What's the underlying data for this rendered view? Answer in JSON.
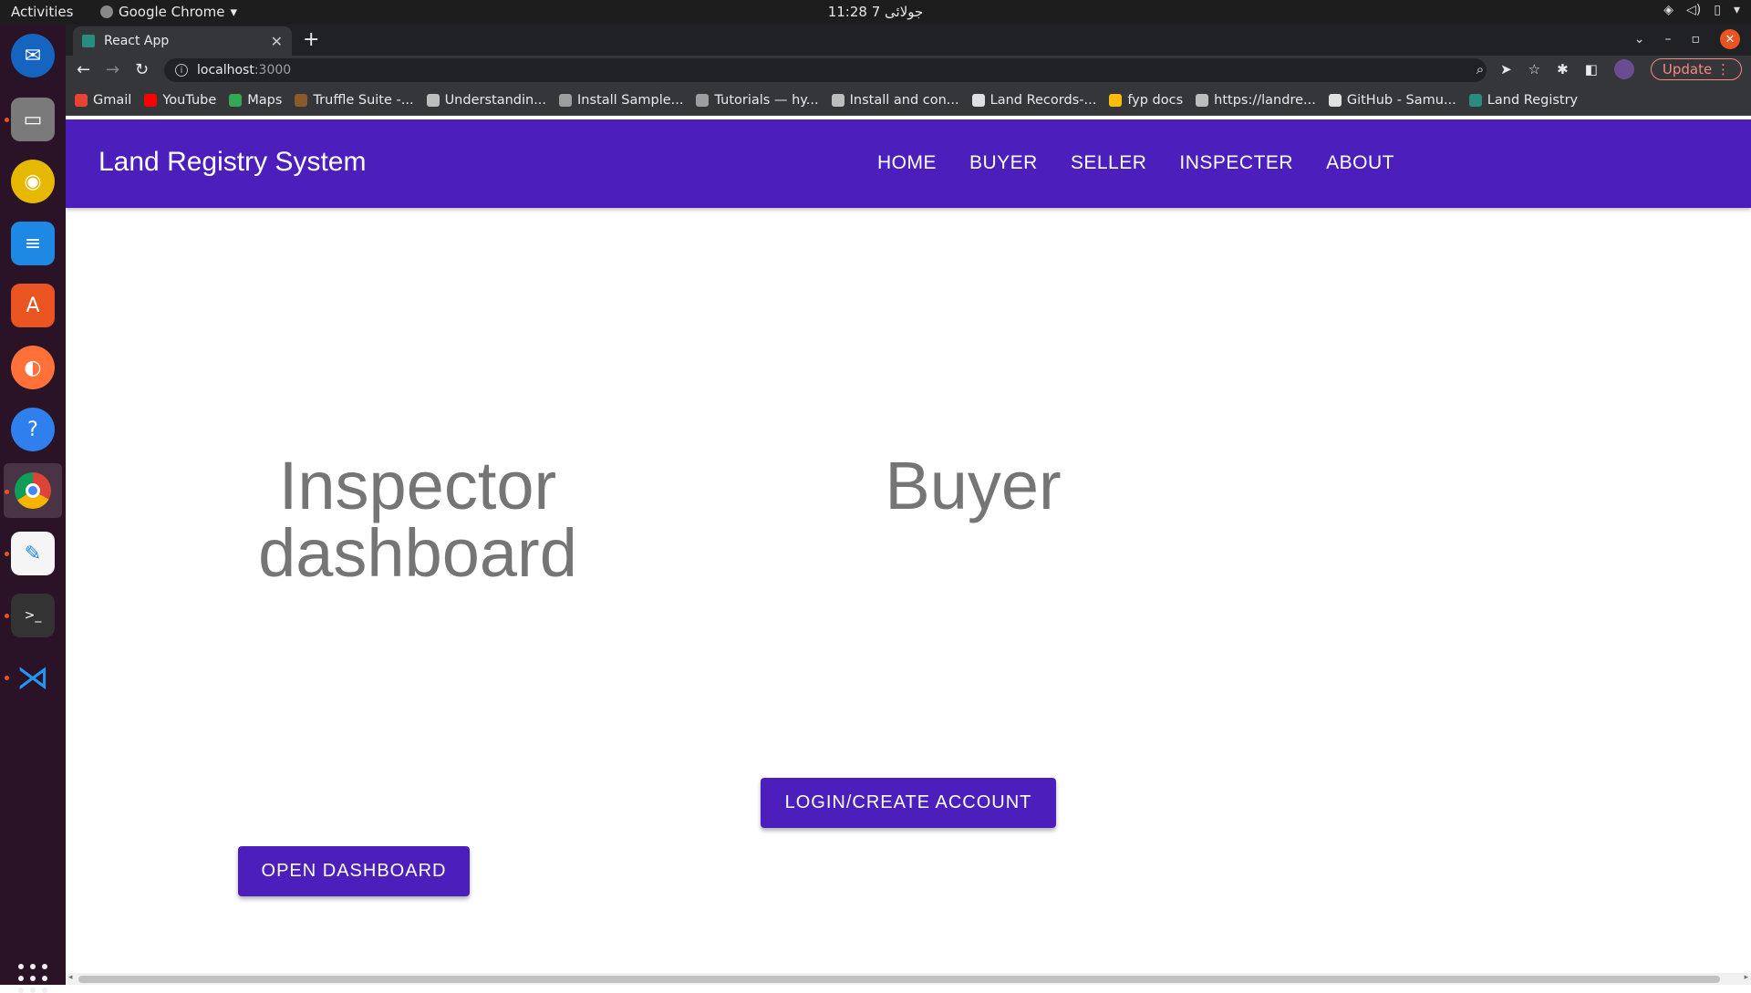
{
  "system": {
    "activities": "Activities",
    "app_menu": "Google Chrome",
    "clock": "جولائی 7  11:28"
  },
  "dock": {
    "apps": [
      "thunderbird-icon",
      "files-icon",
      "rhythmbox-icon",
      "writer-icon",
      "app-center-icon",
      "firefox-icon",
      "help-icon",
      "chrome-icon",
      "text-editor-icon",
      "terminal-icon",
      "vscode-icon"
    ]
  },
  "browser": {
    "tab_title": "React App",
    "url_host": "localhost",
    "url_port": ":3000",
    "update_label": "Update",
    "bookmarks": [
      {
        "label": "Gmail",
        "color": "#ea4335"
      },
      {
        "label": "YouTube",
        "color": "#ff0000"
      },
      {
        "label": "Maps",
        "color": "#34a853"
      },
      {
        "label": "Truffle Suite -...",
        "color": "#8b5a2b"
      },
      {
        "label": "Understandin...",
        "color": "#bdbdbd"
      },
      {
        "label": "Install Sample...",
        "color": "#9e9e9e"
      },
      {
        "label": "Tutorials — hy...",
        "color": "#9e9e9e"
      },
      {
        "label": "Install and con...",
        "color": "#bdbdbd"
      },
      {
        "label": "Land Records-...",
        "color": "#e0e0e0"
      },
      {
        "label": "fyp docs",
        "color": "#fbbc04"
      },
      {
        "label": "https://landre...",
        "color": "#bdbdbd"
      },
      {
        "label": "GitHub - Samu...",
        "color": "#e0e0e0"
      },
      {
        "label": "Land Registry",
        "color": "#2a8c7e"
      }
    ]
  },
  "app": {
    "brand": "Land Registry System",
    "nav": [
      "HOME",
      "BUYER",
      "SELLER",
      "INSPECTER",
      "ABOUT"
    ],
    "cards": {
      "inspector_heading_line1": "Inspector",
      "inspector_heading_line2": "dashboard",
      "inspector_button": "OPEN DASHBOARD",
      "buyer_heading": "Buyer",
      "buyer_button": "LOGIN/CREATE ACCOUNT"
    }
  }
}
